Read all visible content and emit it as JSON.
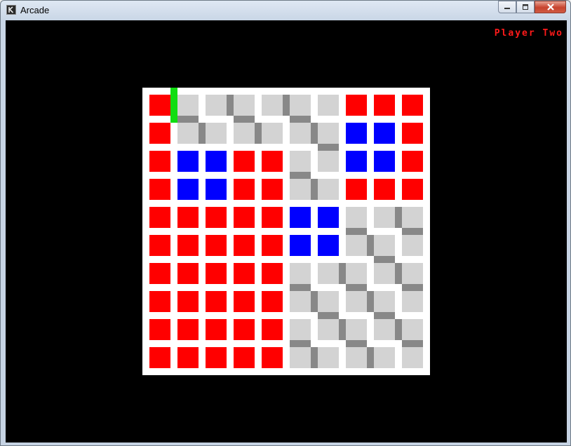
{
  "window": {
    "title": "Arcade",
    "app_icon": "arcade-k-icon",
    "buttons": [
      "minimize-icon",
      "maximize-icon",
      "close-icon"
    ]
  },
  "game": {
    "player_label": "Player Two",
    "colors": {
      "background": "#000000",
      "board": "#ffffff",
      "red": "#ff0000",
      "blue": "#0000ff",
      "light": "#d3d3d3",
      "wall": "#888888",
      "cursor": "#11dd11",
      "label": "#ff1a1a"
    },
    "rows": [
      "RLLLLLLRRR",
      "RLLLLLLBBR",
      "RBBRRLLBBR",
      "RBBRRLLRRR",
      "RRRRRBBLLL",
      "RRRRRBBLLL",
      "RRRRRLLLLL",
      "RRRRRLLLLL",
      "RRRRRLLLLL",
      "RRRRRLLLLL"
    ],
    "cursor": {
      "row": 0,
      "col": 0,
      "side": "right"
    }
  }
}
